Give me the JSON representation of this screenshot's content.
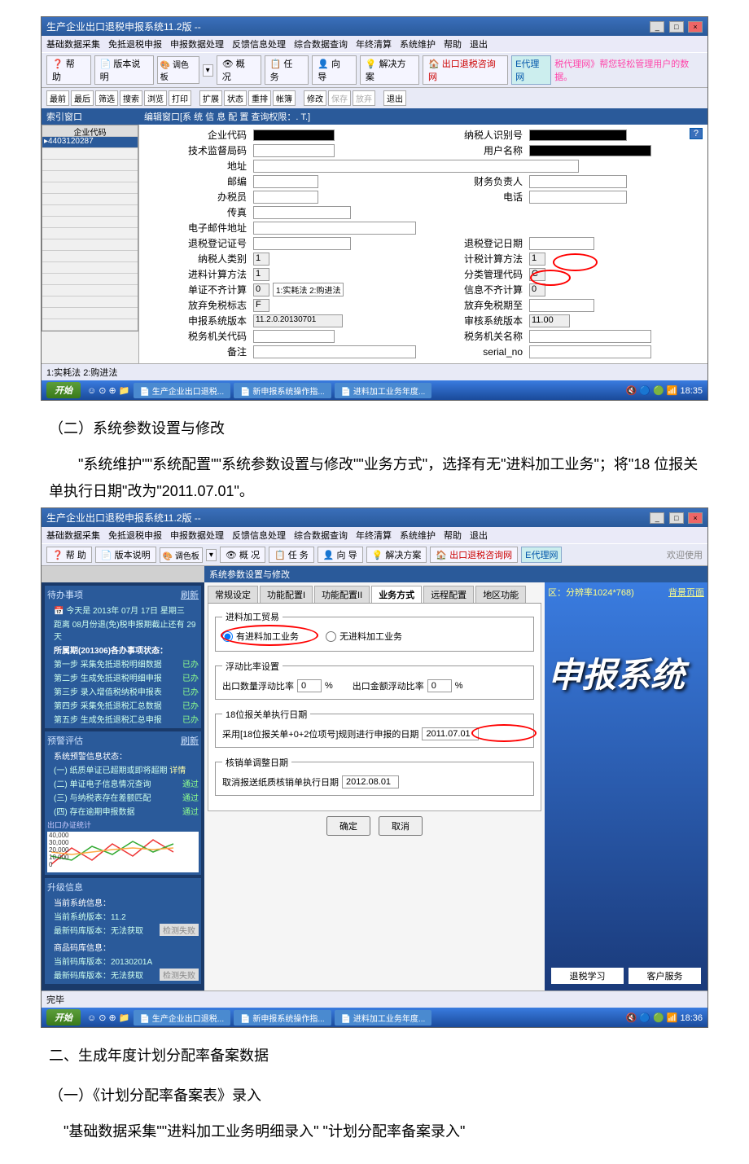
{
  "ss1": {
    "title": "生产企业出口退税申报系统11.2版 --",
    "menus": [
      "基础数据采集",
      "免抵退税申报",
      "申报数据处理",
      "反馈信息处理",
      "综合数据查询",
      "年终清算",
      "系统维护",
      "帮助",
      "退出"
    ],
    "toolbar1": {
      "help": "帮 助",
      "ver": "版本说明",
      "palette": "调色板",
      "overview": "概 况",
      "tasks": "任 务",
      "guide": "向 导",
      "solution": "解决方案",
      "site": "出口退税咨询网",
      "banner": "税代理网》帮您轻松管理用户的数据。"
    },
    "toolbar2": [
      "最前",
      "最后",
      "筛选",
      "搜索",
      "浏览",
      "打印",
      "扩展",
      "状态",
      "重排",
      "帐簿",
      "修改",
      "保存",
      "放弃",
      "退出"
    ],
    "index_panel": "索引窗口",
    "edit_panel": "编辑窗口[系 统 信 息 配 置  查询权限：. T.]",
    "grid_header": "企业代码",
    "grid_value": "4403120287",
    "form": {
      "f1l": "企业代码",
      "f1r": "纳税人识别号",
      "f2l": "技术监督局码",
      "f2r": "用户名称",
      "f3l": "地址",
      "f4l": "邮编",
      "f4r": "财务负责人",
      "f5l": "办税员",
      "f5r": "电话",
      "f6l": "传真",
      "f7l": "电子邮件地址",
      "f8l": "退税登记证号",
      "f8r": "退税登记日期",
      "f9l": "纳税人类别",
      "f9v": "1",
      "f9r": "计税计算方法",
      "f9rv": "1",
      "f10l": "进料计算方法",
      "f10v": "1",
      "f10r": "分类管理代码",
      "f10rv": "C",
      "f11l": "单证不齐计算",
      "f11v": "0",
      "f11note": "1:实耗法  2:购进法",
      "f11r": "信息不齐计算",
      "f11rv": "0",
      "f12l": "放弃免税标志",
      "f12v": "F",
      "f12r": "放弃免税期至",
      "f13l": "申报系统版本",
      "f13v": "11.2.0.20130701",
      "f13r": "审核系统版本",
      "f13rv": "11.00",
      "f14l": "税务机关代码",
      "f14r": "税务机关名称",
      "f15l": "备注",
      "f15r": "serial_no"
    },
    "status": "1:实耗法  2:购进法",
    "taskbar": {
      "start": "开始",
      "t1": "生产企业出口退税...",
      "t2": "新申报系统操作指...",
      "t3": "进料加工业务年度...",
      "time": "18:35"
    }
  },
  "doc": {
    "h1": "（二）系统参数设置与修改",
    "p1": "\"系统维护\"\"系统配置\"\"系统参数设置与修改\"\"业务方式\"，选择有无\"进料加工业务\"；将\"18 位报关单执行日期\"改为\"2011.07.01\"。",
    "h2": "二、生成年度计划分配率备案数据",
    "h3": "（一）《计划分配率备案表》录入",
    "p2": "\"基础数据采集\"\"进料加工业务明细录入\" \"计划分配率备案录入\""
  },
  "ss2": {
    "title": "生产企业出口退税申报系统11.2版 --",
    "menus": [
      "基础数据采集",
      "免抵退税申报",
      "申报数据处理",
      "反馈信息处理",
      "综合数据查询",
      "年终清算",
      "系统维护",
      "帮助",
      "退出"
    ],
    "panel_title": "系统参数设置与修改",
    "left": {
      "sec1_title": "待办事项",
      "refresh": "刷新",
      "date_line": "今天是 2013年 07月 17日 星期三",
      "deadline": "距离 08月份退(免)税申报期截止还有 29天",
      "sec2_title": "所属期(201306)各办事项状态：",
      "step1": "第一步  采集免抵退税明细数据",
      "done": "已办",
      "step2": "第二步  生成免抵退税明细申报",
      "step3": "第三步  录入增值税纳税申报表",
      "step4": "第四步  采集免抵退税汇总数据",
      "step5": "第五步  生成免抵退税汇总申报",
      "sec3_title": "预警评估",
      "sec3_sub": "系统预警信息状态：",
      "w1": "(一) 纸质单证已超期或即将超期",
      "w1s": "详情",
      "w2": "(二) 单证电子信息情况查询",
      "w2s": "通过",
      "w3": "(三) 与纳税表存在差额匹配",
      "w3s": "通过",
      "w4": "(四) 存在逾期申报数据",
      "w4s": "通过",
      "chart_label": "出口办证统计",
      "sec4_title": "升级信息",
      "sys_info": "当前系统信息：",
      "sys_ver": "当前系统版本：11.2",
      "code_ver": "最新码库版本：无法获取",
      "goods_info": "商品码库信息：",
      "goods_ver": "当前码库版本：20130201A",
      "goods_new": "最新码库版本：无法获取",
      "check": "检测失败"
    },
    "tabs": [
      "常规设定",
      "功能配置I",
      "功能配置II",
      "业务方式",
      "远程配置",
      "地区功能"
    ],
    "fs1": {
      "legend": "进料加工贸易",
      "r1": "有进料加工业务",
      "r2": "无进料加工业务"
    },
    "fs2": {
      "legend": "浮动比率设置",
      "l1": "出口数量浮动比率",
      "v1": "0",
      "u": "%",
      "l2": "出口金额浮动比率",
      "v2": "0"
    },
    "fs3": {
      "legend": "18位报关单执行日期",
      "label": "采用[18位报关单+0+2位项号]规则进行申报的日期",
      "value": "2011.07.01"
    },
    "fs4": {
      "legend": "核销单调整日期",
      "label": "取消报送纸质核销单执行日期",
      "value": "2012.08.01"
    },
    "ok": "确定",
    "cancel": "取消",
    "right": {
      "res": "区：分辨率1024*768)",
      "bg": "背景页面",
      "big": "申报系统",
      "learn": "退税学习",
      "svc": "客户服务"
    },
    "status2": "完毕",
    "taskbar": {
      "start": "开始",
      "t1": "生产企业出口退税...",
      "t2": "新申报系统操作指...",
      "t3": "进料加工业务年度...",
      "time": "18:36"
    }
  }
}
